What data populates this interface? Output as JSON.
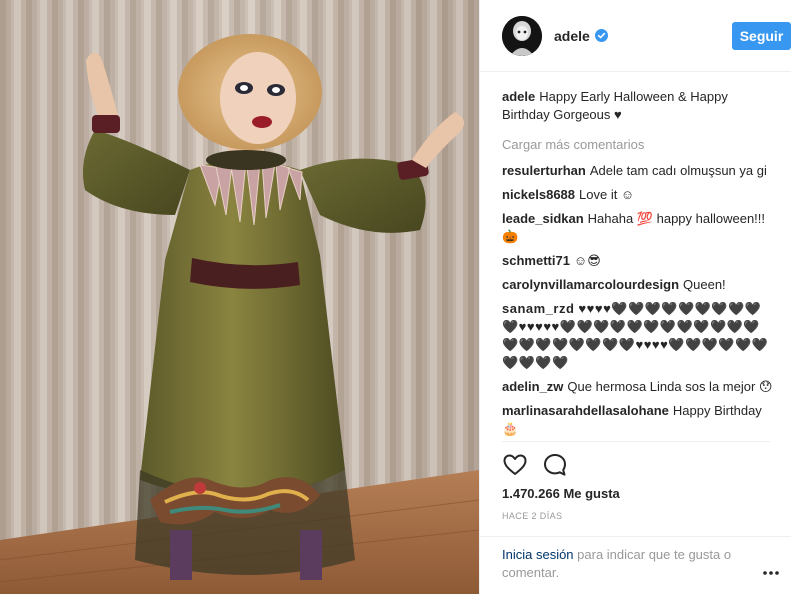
{
  "post": {
    "author": "adele",
    "follow_label": "Seguir",
    "caption_user": "adele",
    "caption_text": "Happy Early Halloween & Happy Birthday Gorgeous ♥",
    "load_more": "Cargar más comentarios",
    "comments": [
      {
        "user": "resulerturhan",
        "text": "Adele tam cadı olmuşsun ya gi"
      },
      {
        "user": "nickels8688",
        "text": "Love it ☺"
      },
      {
        "user": "leade_sidkan",
        "text": "Hahaha 💯 happy halloween!!!🎃"
      },
      {
        "user": "schmetti71",
        "text": "☺😎"
      },
      {
        "user": "carolynvillamarcolourdesign",
        "text": "Queen!"
      },
      {
        "user": "sanam_rzd",
        "text": "♥♥♥♥🖤🖤🖤🖤🖤🖤🖤🖤🖤🖤♥♥♥♥♥🖤🖤🖤🖤🖤🖤🖤🖤🖤🖤🖤🖤🖤🖤🖤🖤🖤🖤🖤🖤♥♥♥♥🖤🖤🖤🖤🖤🖤🖤🖤🖤🖤"
      },
      {
        "user": "adelin_zw",
        "text": "Que hermosa Linda sos la mejor 😯"
      },
      {
        "user": "marlinasarahdellasalohane",
        "text": "Happy Birthday 🎂"
      }
    ],
    "likes": "1.470.266 Me gusta",
    "time": "HACE 2 DÍAS",
    "login_link": "Inicia sesión",
    "login_rest": " para indicar que te gusta o comentar."
  },
  "icons": {
    "verified": "verified-badge-icon",
    "like": "heart-outline-icon",
    "comment": "comment-bubble-icon",
    "more": "more-options-icon"
  },
  "colors": {
    "follow_button": "#3897f0",
    "verified_badge": "#3897f0",
    "login_link": "#003569",
    "muted_text": "#999999",
    "divider": "#efefef"
  }
}
